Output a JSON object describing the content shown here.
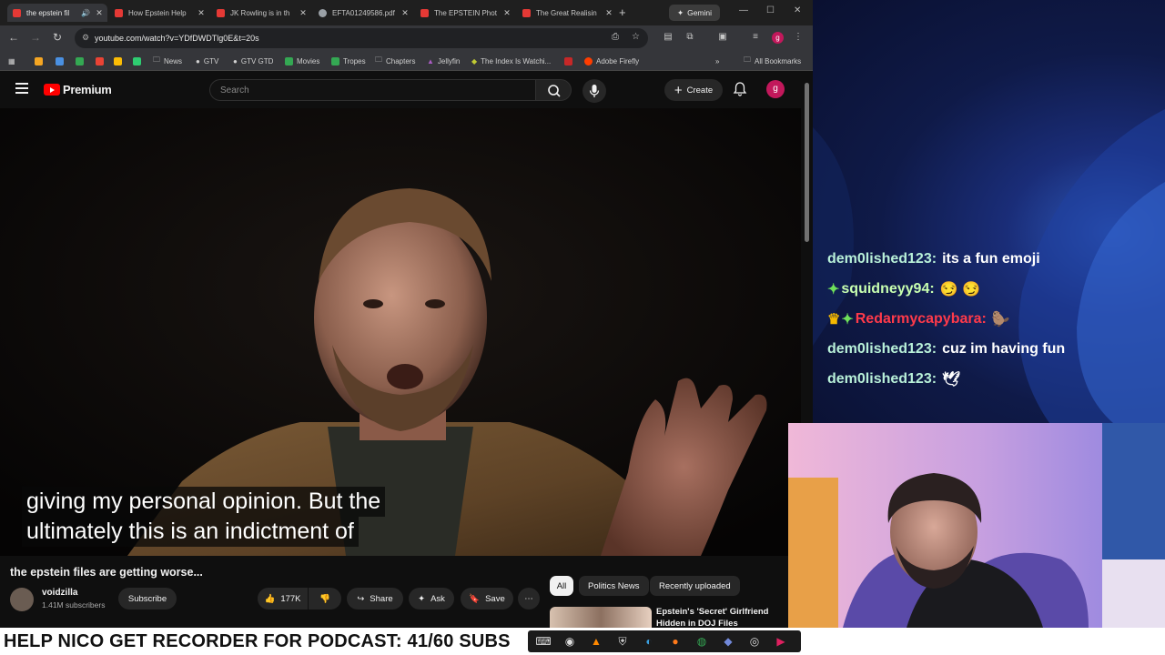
{
  "browser": {
    "tabs": [
      {
        "label": "the epstein fil",
        "active": true
      },
      {
        "label": "How Epstein Help"
      },
      {
        "label": "JK Rowling is in th"
      },
      {
        "label": "EFTA01249586.pdf"
      },
      {
        "label": "The EPSTEIN Phot"
      },
      {
        "label": "The Great Realisin"
      }
    ],
    "gemini_label": "Gemini",
    "url": "youtube.com/watch?v=YDfDWDTlg0E&t=20s",
    "profile_initial": "g",
    "bookmarks": [
      "News",
      "GTV",
      "GTV GTD",
      "Movies",
      "Tropes",
      "Chapters",
      "Jellyfin",
      "The Index Is Watchi...",
      "Adobe Firefly"
    ],
    "all_bookmarks": "All Bookmarks"
  },
  "youtube": {
    "brand": "Premium",
    "search_placeholder": "Search",
    "create_label": "Create",
    "avatar_initial": "g",
    "captions": [
      "giving my personal opinion. But the",
      "ultimately this is an indictment of"
    ],
    "video_title": "the epstein files are getting worse...",
    "channel_name": "voidzilla",
    "channel_subs": "1.41M subscribers",
    "subscribe_label": "Subscribe",
    "like_count": "177K",
    "share_label": "Share",
    "ask_label": "Ask",
    "save_label": "Save",
    "chips": [
      "All",
      "Politics News",
      "Recently uploaded"
    ],
    "rec_title": "Epstein's 'Secret' Girlfriend Hidden in DOJ Files"
  },
  "chat": [
    {
      "user": "dem0lished123:",
      "message": "its a fun emoji",
      "color": "#b8f0d8"
    },
    {
      "user": "squidneyy94:",
      "message": "😏 😏",
      "color": "#c8ffb0",
      "badge": "✦"
    },
    {
      "user": "Redarmycapybara:",
      "message": "🦫",
      "color": "#ff3a4a",
      "badge": "👑✦"
    },
    {
      "user": "dem0lished123:",
      "message": "cuz im having fun",
      "color": "#b8f0d8"
    },
    {
      "user": "dem0lished123:",
      "message": "🕊",
      "color": "#b8f0d8"
    }
  ],
  "banner": "HELP NICO GET RECORDER FOR PODCAST: 41/60 SUBS"
}
